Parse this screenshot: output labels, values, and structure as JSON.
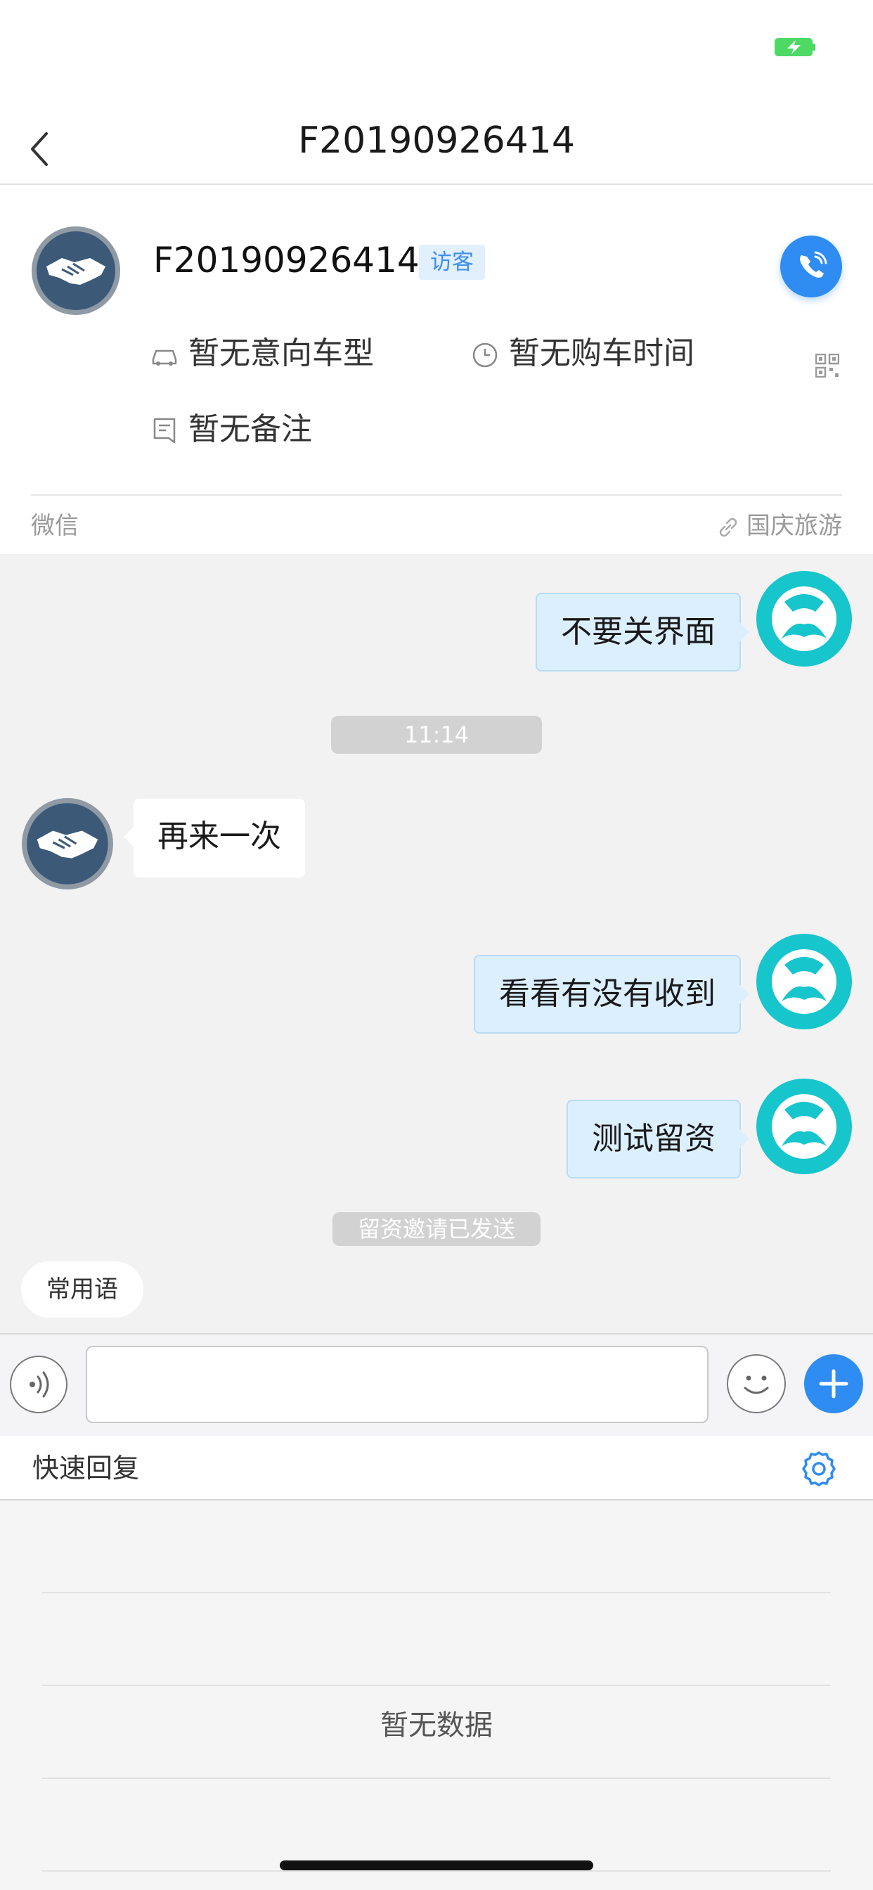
{
  "nav": {
    "title": "F20190926414"
  },
  "customer": {
    "name": "F20190926414",
    "badge": "访客",
    "car_model": "暂无意向车型",
    "purchase_time": "暂无购车时间",
    "remark": "暂无备注",
    "channel": "微信",
    "source": "国庆旅游"
  },
  "messages": [
    {
      "from": "agent",
      "text": "不要关界面"
    },
    {
      "type": "time",
      "text": "11:14"
    },
    {
      "from": "customer",
      "text": "再来一次"
    },
    {
      "from": "agent",
      "text": "看看有没有收到"
    },
    {
      "from": "agent",
      "text": "测试留资"
    },
    {
      "type": "notice",
      "text": "留资邀请已发送"
    }
  ],
  "common_phrases_label": "常用语",
  "input": {
    "value": "",
    "placeholder": ""
  },
  "quick_reply": {
    "title": "快速回复",
    "empty_text": "暂无数据"
  },
  "colors": {
    "accent": "#2f8cf2",
    "agent_avatar": "#17c5cc",
    "bubble_me": "#dcefff",
    "battery": "#4cd964"
  }
}
